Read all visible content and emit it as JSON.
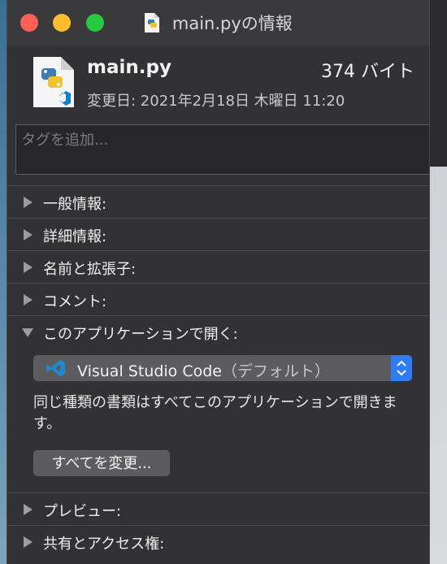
{
  "window": {
    "title": "main.pyの情報"
  },
  "file": {
    "name": "main.py",
    "size": "374 バイト",
    "modified": "変更日: 2021年2月18日 木曜日 11:20"
  },
  "tags": {
    "placeholder": "タグを追加..."
  },
  "sections": {
    "general": "一般情報:",
    "more_info": "詳細情報:",
    "name_ext": "名前と拡張子:",
    "comments": "コメント:",
    "open_with": "このアプリケーションで開く:",
    "preview": "プレビュー:",
    "sharing": "共有とアクセス権:"
  },
  "open_with": {
    "app_name": "Visual Studio Code",
    "app_default": "（デフォルト）",
    "description": "同じ種類の書類はすべてこのアプリケーションで開きます。",
    "change_all_label": "すべてを変更..."
  },
  "colors": {
    "close": "#fe5f57",
    "minimize": "#febc2e",
    "maximize": "#28c840",
    "accent": "#2f7cf6",
    "vscode_blue": "#0b7fd0"
  },
  "icons": {
    "title_icon": "python-file-icon",
    "file_icon": "python-file-vscode-icon",
    "app_icon": "vscode-icon",
    "stepper_icon": "up-down-chevrons-icon"
  }
}
